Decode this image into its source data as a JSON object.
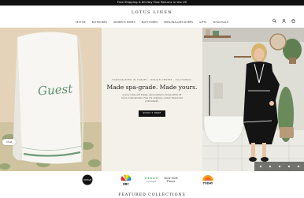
{
  "promo": {
    "text": "Free Shipping & 60-Day Free Returns in the US"
  },
  "header": {
    "logo": "LOTUS LINEN",
    "nav": [
      "TEXTILE",
      "BATHROBES",
      "WOMEN'S ROBES",
      "BATH ROBES",
      "PERSONALIZED ROBES",
      "GIFTS",
      "WHOLESALE"
    ],
    "icons": [
      "search-icon",
      "account-icon",
      "cart-icon"
    ]
  },
  "hero": {
    "left_image_text": "Guest",
    "eyebrow": "HANDCRAFTED IN TURKEY · DESIGN CENTER · CALIFORNIA",
    "headline": "Made spa-grade. Made yours.",
    "body": "Luxury robes and towels, personalized in-house within 24 hours in Sacramento. Free U.S. shipping, custom thread and embroidered.",
    "cta": "SHOP IT HERE"
  },
  "chat": {
    "label": "Chat"
  },
  "press": {
    "logos": [
      "Oprah Daily",
      "NBC",
      "5-star reviews",
      "The New York Times",
      "TODAY"
    ],
    "review_caption": "★★★★★",
    "review_sub": "by Google",
    "nyt_line1": "New York",
    "nyt_line2": "Times"
  },
  "section": {
    "heading": "FEATURED COLLECTIONS"
  },
  "colors": {
    "promo_bg": "#101010",
    "cta_bg": "#121212",
    "hero_mid_bg": "#f4f1ea",
    "towel_embroidery": "#5f8f70"
  }
}
